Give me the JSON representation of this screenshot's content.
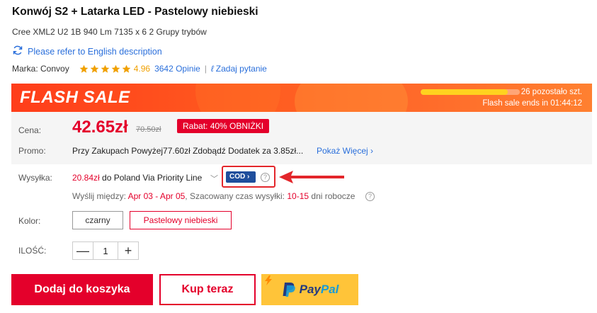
{
  "product": {
    "title": "Konwój S2 + Latarka LED - Pastelowy niebieski",
    "subtitle": "Cree XML2 U2 1B 940 Lm 7135 x 6 2 Grupy trybów",
    "english_link": "Please refer to English description",
    "english_link_icon": "refresh-icon",
    "brand": "Marka: Convoy",
    "rating": "4.96",
    "stars": 5,
    "reviews": "3642 Opinie",
    "separator": "|",
    "ask_question": "Zadaj pytanie",
    "ask_icon": "pen-icon"
  },
  "flash_sale": {
    "title": "FLASH SALE",
    "items_left": "26 pozostało szt.",
    "ends": "Flash sale ends in 01:44:12",
    "progress": 0.88,
    "colors": {
      "bar": "#ffd21f",
      "background": "#ff4f1f"
    }
  },
  "pricing": {
    "price_label": "Cena:",
    "price": "42.65zł",
    "old_price": "70.50zł",
    "discount": "Rabat: 40% OBNIŻKI",
    "promo_label": "Promo:",
    "promo_text": "Przy Zakupach Powyżej77.60zł Zdobądź Dodatek za 3.85zł...",
    "promo_more": "Pokaż Więcej",
    "promo_more_icon": "chevron-right-icon"
  },
  "shipping": {
    "label": "Wysyłka:",
    "price": "20.84zł",
    "destination": "do Poland Via Priority Line",
    "dropdown_icon": "chevron-down-icon",
    "cod": "COD",
    "cod_icon": "chevron-right-icon",
    "help_icon": "question-circle-icon",
    "date_prefix": "Wyślij między:",
    "date_range": "Apr 03 - Apr 05",
    "estimate_prefix": ", Szacowany czas wysyłki:",
    "estimate_days": "10-15",
    "estimate_suffix": "dni robocze",
    "annotation_icon": "red-arrow-icon"
  },
  "color": {
    "label": "Kolor:",
    "options": [
      "czarny",
      "Pastelowy niebieski"
    ],
    "selected": "Pastelowy niebieski"
  },
  "quantity": {
    "label": "ILOŚĆ:",
    "value": "1",
    "minus": "—",
    "plus": "+"
  },
  "actions": {
    "add_to_cart": "Dodaj do koszyka",
    "buy_now": "Kup teraz",
    "paypal_pay": "Pay",
    "paypal_pal": "Pal",
    "paypal_icon": "paypal-logo-icon"
  },
  "colors": {
    "accent": "#e4002b",
    "link": "#2a6fdb",
    "star": "#f0a000",
    "cod_badge": "#1f4e9c",
    "paypal": "#ffc439"
  }
}
